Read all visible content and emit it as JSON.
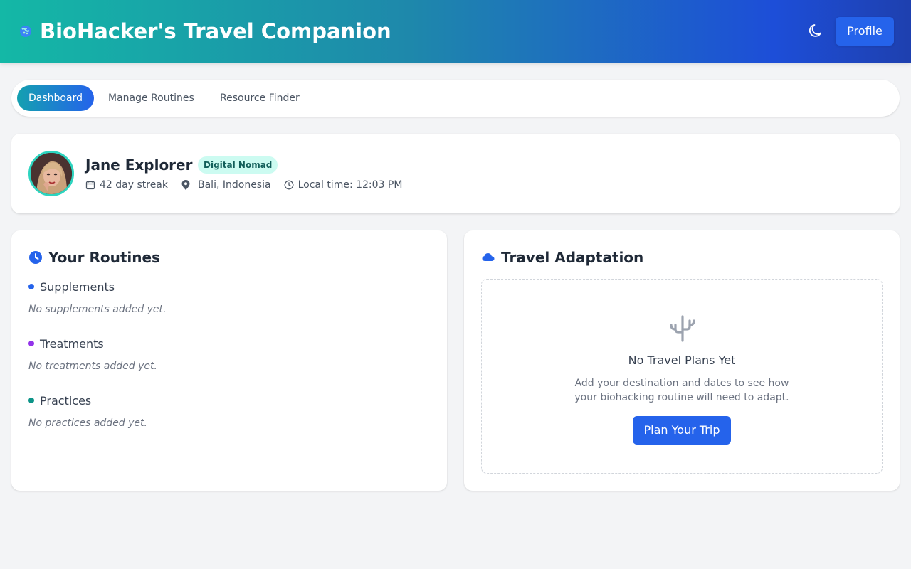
{
  "header": {
    "logo_icon": "dna-globe-icon",
    "title": "BioHacker's Travel Companion",
    "theme_toggle_icon": "moon-icon",
    "profile_label": "Profile"
  },
  "nav": {
    "tabs": [
      {
        "label": "Dashboard",
        "active": true
      },
      {
        "label": "Manage Routines",
        "active": false
      },
      {
        "label": "Resource Finder",
        "active": false
      }
    ]
  },
  "user": {
    "name": "Jane Explorer",
    "badge": "Digital Nomad",
    "streak": "42 day streak",
    "location": "Bali, Indonesia",
    "local_time": "Local time: 12:03 PM"
  },
  "routines": {
    "title": "Your Routines",
    "sections": [
      {
        "label": "Supplements",
        "empty": "No supplements added yet.",
        "color": "#2563eb"
      },
      {
        "label": "Treatments",
        "empty": "No treatments added yet.",
        "color": "#9333ea"
      },
      {
        "label": "Practices",
        "empty": "No practices added yet.",
        "color": "#0d9488"
      }
    ]
  },
  "travel": {
    "title": "Travel Adaptation",
    "empty_title": "No Travel Plans Yet",
    "empty_desc": "Add your destination and dates to see how your biohacking routine will need to adapt.",
    "plan_button": "Plan Your Trip"
  },
  "colors": {
    "primary": "#2563eb",
    "accent_teal": "#14b8a6",
    "badge_bg": "#ccfbf1",
    "badge_text": "#115e59"
  }
}
